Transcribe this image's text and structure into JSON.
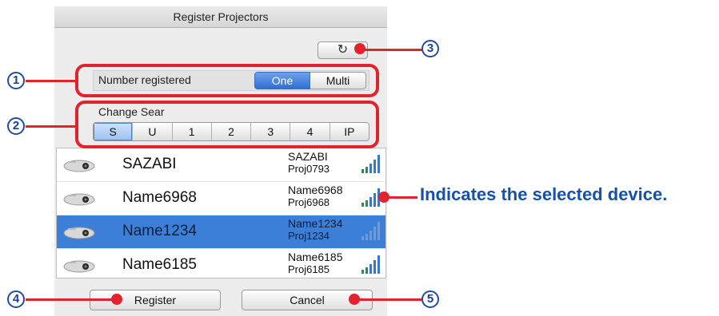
{
  "window": {
    "title": "Register Projectors"
  },
  "toolbar": {
    "refresh_icon": "refresh-icon",
    "refresh_glyph": "↻"
  },
  "registration": {
    "label": "Number registered",
    "options": [
      "One",
      "Multi"
    ],
    "selected": "One"
  },
  "search": {
    "label": "Change Sear",
    "tabs": [
      "S",
      "U",
      "1",
      "2",
      "3",
      "4",
      "IP"
    ],
    "selected": "S"
  },
  "devices": [
    {
      "name": "SAZABI",
      "ssid": "SAZABI",
      "proj_id": "Proj0793",
      "selected": false
    },
    {
      "name": "Name6968",
      "ssid": "Name6968",
      "proj_id": "Proj6968",
      "selected": false
    },
    {
      "name": "Name1234",
      "ssid": "Name1234",
      "proj_id": "Proj1234",
      "selected": true
    },
    {
      "name": "Name6185",
      "ssid": "Name6185",
      "proj_id": "Proj6185",
      "selected": false
    }
  ],
  "footer": {
    "register_label": "Register",
    "cancel_label": "Cancel"
  },
  "annotations": {
    "callouts": [
      "1",
      "2",
      "3",
      "4",
      "5"
    ],
    "caption": "Indicates the selected device.",
    "colors": {
      "highlight": "#e0232d",
      "callout_text": "#1e3f96",
      "caption": "#1750a8",
      "selection": "#3b7fd8"
    }
  }
}
